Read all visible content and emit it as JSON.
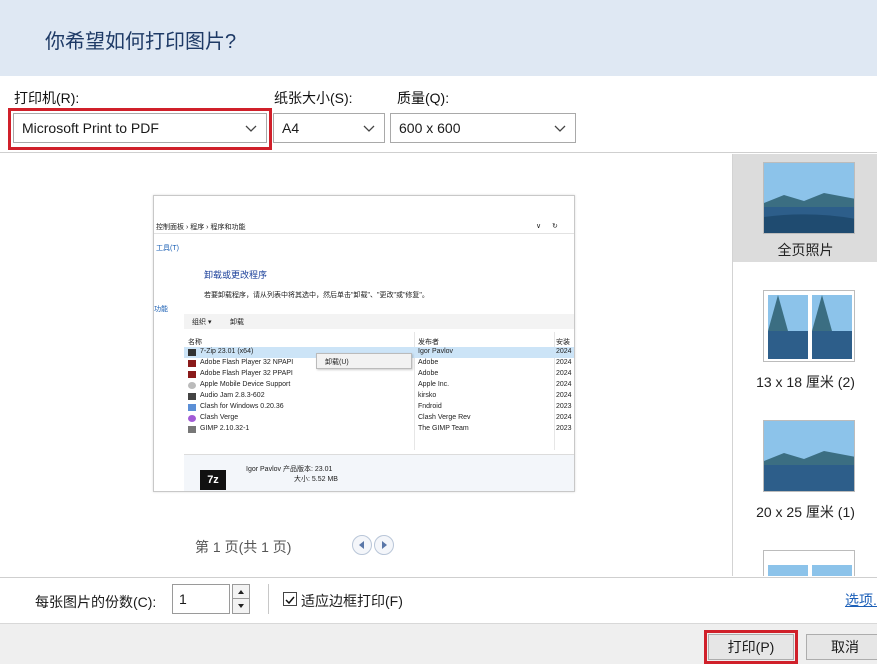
{
  "dialog": {
    "title": "你希望如何打印图片?"
  },
  "printer": {
    "label": "打印机(R):",
    "value": "Microsoft Print to PDF"
  },
  "paper": {
    "label": "纸张大小(S):",
    "value": "A4"
  },
  "quality": {
    "label": "质量(Q):",
    "value": "600 x 600"
  },
  "layouts": [
    {
      "label": "全页照片",
      "selected": true
    },
    {
      "label": "13 x 18 厘米 (2)",
      "selected": false
    },
    {
      "label": "20 x 25 厘米 (1)",
      "selected": false
    },
    {
      "label": "",
      "selected": false
    }
  ],
  "preview": {
    "breadcrumb": "控制面板 › 程序 › 程序和功能",
    "tool_label": "工具(T)",
    "heading": "卸载或更改程序",
    "description": "若要卸载程序，请从列表中将其选中，然后单击\"卸载\"、\"更改\"或\"修复\"。",
    "sidebar_link": "功能",
    "toolbar": [
      "组织 ▾",
      "卸载"
    ],
    "columns": [
      "名称",
      "发布者",
      "安装"
    ],
    "context_menu": "卸载(U)",
    "rows": [
      {
        "name": "7-Zip 23.01 (x64)",
        "publisher": "Igor Pavlov",
        "date": "2024"
      },
      {
        "name": "Adobe Flash Player 32 NPAPI",
        "publisher": "Adobe",
        "date": "2024"
      },
      {
        "name": "Adobe Flash Player 32 PPAPI",
        "publisher": "Adobe",
        "date": "2024"
      },
      {
        "name": "Apple Mobile Device Support",
        "publisher": "Apple Inc.",
        "date": "2024"
      },
      {
        "name": "Audio Jam 2.8.3-602",
        "publisher": "kirsko",
        "date": "2024"
      },
      {
        "name": "Clash for Windows 0.20.36",
        "publisher": "Fndroid",
        "date": "2023"
      },
      {
        "name": "Clash Verge",
        "publisher": "Clash Verge Rev",
        "date": "2024"
      },
      {
        "name": "GIMP 2.10.32-1",
        "publisher": "The GIMP Team",
        "date": "2023"
      }
    ],
    "details_line1": "Igor Pavlov 产品版本: 23.01",
    "details_line2": "大小: 5.52 MB",
    "logo": "7z"
  },
  "pager": {
    "text": "第 1 页(共 1 页)"
  },
  "copies": {
    "label": "每张图片的份数(C):",
    "value": "1"
  },
  "fit": {
    "label": "适应边框打印(F)",
    "checked": true
  },
  "options_link": "选项...",
  "buttons": {
    "print": "打印(P)",
    "cancel": "取消"
  },
  "colors": {
    "header_bg": "#dfe8f3",
    "highlight": "#d0202a",
    "link": "#1b5fb8"
  }
}
